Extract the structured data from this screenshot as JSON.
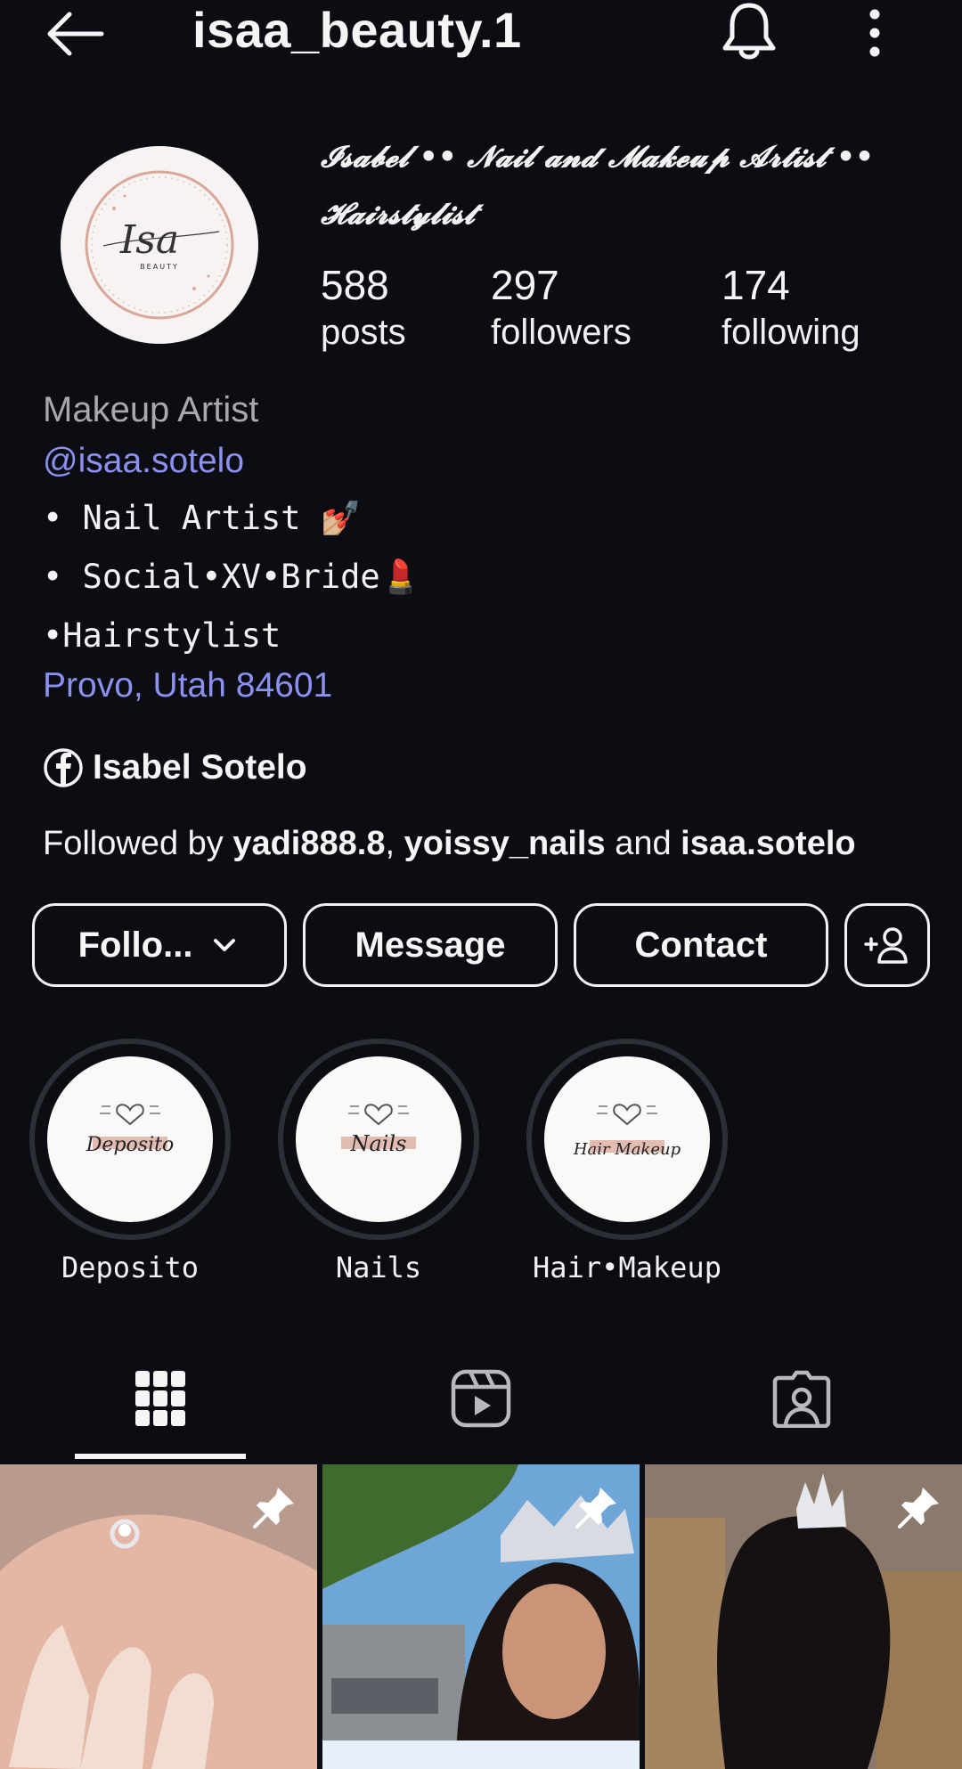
{
  "header": {
    "username": "isaa_beauty.1"
  },
  "profile": {
    "display_name": "𝓘𝓼𝓪𝓫𝓮𝓵 •• 𝓝𝓪𝓲𝓵 𝓪𝓷𝓭 𝓜𝓪𝓴𝓮𝓾𝓹 𝓐𝓻𝓽𝓲𝓼𝓽 •• 𝓗𝓪𝓲𝓻𝓼𝓽𝔂𝓵𝓲𝓼𝓽",
    "avatar_text": "Isa",
    "avatar_subtext": "BEAUTY",
    "stats": [
      {
        "value": "588",
        "label": "posts"
      },
      {
        "value": "297",
        "label": "followers"
      },
      {
        "value": "174",
        "label": "following"
      }
    ]
  },
  "bio": {
    "category": "Makeup Artist",
    "mention": "@isaa.sotelo",
    "lines": [
      "• Nail Artist 💅🏼",
      "• Social•XV•Bride💄",
      "•Hairstylist"
    ],
    "location": "Provo, Utah 84601",
    "facebook_name": "Isabel Sotelo",
    "followed_by_prefix": "Followed by ",
    "followed_by_1": "yadi888.8",
    "followed_by_sep": ", ",
    "followed_by_2": "yoissy_nails",
    "followed_by_and": " and ",
    "followed_by_3": "isaa.sotelo"
  },
  "actions": {
    "follow_label": "Follo...",
    "message_label": "Message",
    "contact_label": "Contact"
  },
  "highlights": [
    {
      "label": "Deposito",
      "cover_text": "Deposito"
    },
    {
      "label": "Nails",
      "cover_text": "Nails"
    },
    {
      "label": "Hair•Makeup",
      "cover_text": "Hair Makeup"
    }
  ],
  "tabs": [
    {
      "icon": "grid-icon",
      "active": true
    },
    {
      "icon": "reels-icon",
      "active": false
    },
    {
      "icon": "tagged-icon",
      "active": false
    }
  ],
  "posts": [
    {
      "icon": "pin-icon",
      "subject": "manicured hand with ring"
    },
    {
      "icon": "pin-icon",
      "subject": "quinceañera makeup portrait"
    },
    {
      "icon": "pin-icon",
      "subject": "curly updo with tiara"
    }
  ],
  "colors": {
    "background": "#0b0d12",
    "link": "#8c90f0",
    "muted": "#a8a8ad"
  }
}
